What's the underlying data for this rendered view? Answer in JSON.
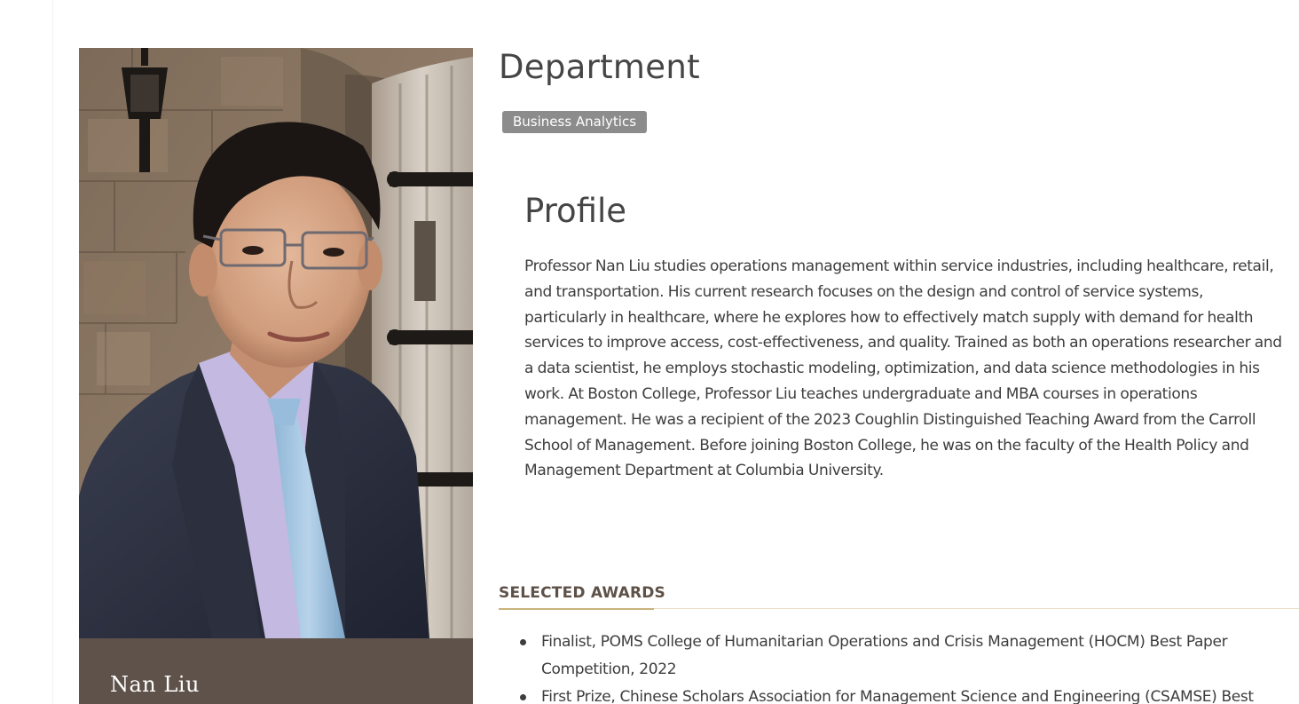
{
  "faculty": {
    "name": "Nan Liu",
    "photo": "portrait-photo"
  },
  "department": {
    "heading": "Department",
    "tag": "Business Analytics"
  },
  "profile": {
    "heading": "Profile",
    "text": "Professor Nan Liu studies operations management within service industries, including healthcare, retail, and transportation. His current research focuses on the design and control of service systems, particularly in healthcare, where he explores how to effectively match supply with demand for health services to improve access, cost-effectiveness, and quality. Trained as both an operations researcher and a data scientist, he employs stochastic modeling, optimization, and data science methodologies in his work. At Boston College, Professor Liu teaches undergraduate and MBA courses in operations management. He was a recipient of the 2023 Coughlin Distinguished Teaching Award from the Carroll School of Management. Before joining Boston College, he was on the faculty of the Health Policy and Management Department at Columbia University."
  },
  "awards": {
    "heading": "SELECTED AWARDS",
    "items": [
      "Finalist, POMS College of Humanitarian Operations and Crisis Management (HOCM) Best Paper Competition, 2022",
      "First Prize, Chinese Scholars Association for Management Science and Engineering (CSAMSE) Best"
    ]
  },
  "colors": {
    "name_plate": "#5e524a",
    "badge": "#8c8c8c",
    "awards_accent": "#c9b27d",
    "awards_heading": "#5e5148"
  }
}
